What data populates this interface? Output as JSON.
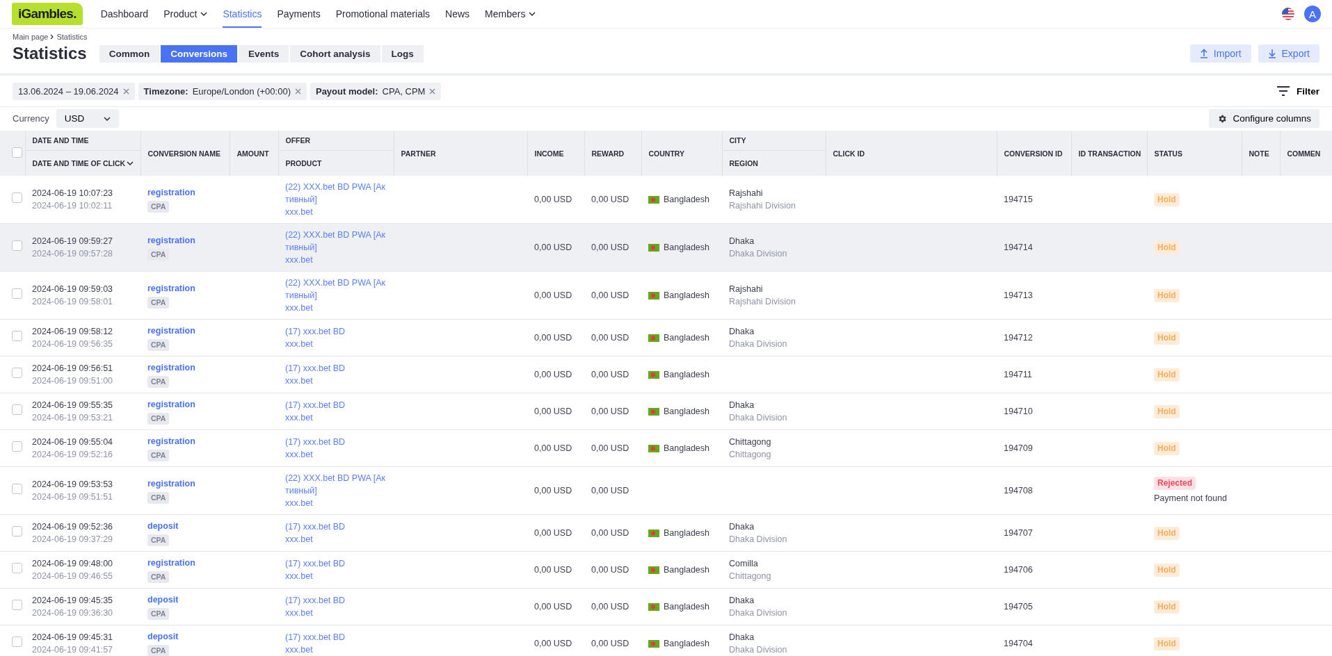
{
  "nav": {
    "logo": "iGambles.",
    "items": [
      {
        "label": "Dashboard",
        "selected": false,
        "dropdown": false
      },
      {
        "label": "Product",
        "selected": false,
        "dropdown": true
      },
      {
        "label": "Statistics",
        "selected": true,
        "dropdown": false
      },
      {
        "label": "Payments",
        "selected": false,
        "dropdown": false
      },
      {
        "label": "Promotional materials",
        "selected": false,
        "dropdown": false
      },
      {
        "label": "News",
        "selected": false,
        "dropdown": false
      },
      {
        "label": "Members",
        "selected": false,
        "dropdown": true
      }
    ],
    "avatar": "A"
  },
  "breadcrumb": [
    "Main page",
    "Statistics"
  ],
  "title": "Statistics",
  "tabs": [
    {
      "label": "Common",
      "selected": false
    },
    {
      "label": "Conversions",
      "selected": true
    },
    {
      "label": "Events",
      "selected": false
    },
    {
      "label": "Cohort analysis",
      "selected": false
    },
    {
      "label": "Logs",
      "selected": false
    }
  ],
  "actions": [
    {
      "label": "Import",
      "kind": "import"
    },
    {
      "label": "Export",
      "kind": "export"
    }
  ],
  "filters": [
    {
      "value": "13.06.2024 – 19.06.2024"
    },
    {
      "label": "Timezone:",
      "value": "Europe/London (+00:00)"
    },
    {
      "label": "Payout model:",
      "value": "CPA, CPM"
    }
  ],
  "filter_button": "Filter",
  "currency": {
    "label": "Currency",
    "value": "USD"
  },
  "configure_button": "Configure columns",
  "table": {
    "select_all_checked": false,
    "columns": [
      {
        "label": "DATE AND TIME",
        "sub": "DATE AND TIME OF CLICK"
      },
      {
        "label": "CONVERSION NAME"
      },
      {
        "label": "AMOUNT"
      },
      {
        "label": "OFFER",
        "sub": "PRODUCT"
      },
      {
        "label": "PARTNER"
      },
      {
        "label": "INCOME"
      },
      {
        "label": "REWARD"
      },
      {
        "label": "COUNTRY"
      },
      {
        "label": "CITY",
        "sub": "REGION"
      },
      {
        "label": "CLICK ID"
      },
      {
        "label": "CONVERSION ID"
      },
      {
        "label": "ID TRANSACTION"
      },
      {
        "label": "STATUS"
      },
      {
        "label": "NOTE"
      },
      {
        "label": "COMMEN"
      }
    ],
    "rows": [
      {
        "checked": false,
        "highlighted": false,
        "date": "2024-06-19 10:07:23",
        "click_date": "2024-06-19 10:02:11",
        "name": "registration",
        "model": "CPA",
        "offer": "(22) XXX.bet BD PWA [Активный]",
        "product": "xxx.bet",
        "income": "0,00 USD",
        "reward": "0,00 USD",
        "country": "Bangladesh",
        "city": "Rajshahi",
        "region": "Rajshahi Division",
        "conversion_id": "194715",
        "status": {
          "kind": "hold",
          "label": "Hold"
        }
      },
      {
        "checked": false,
        "highlighted": true,
        "date": "2024-06-19 09:59:27",
        "click_date": "2024-06-19 09:57:28",
        "name": "registration",
        "model": "CPA",
        "offer": "(22) XXX.bet BD PWA [Активный]",
        "product": "xxx.bet",
        "income": "0,00 USD",
        "reward": "0,00 USD",
        "country": "Bangladesh",
        "city": "Dhaka",
        "region": "Dhaka Division",
        "conversion_id": "194714",
        "status": {
          "kind": "hold",
          "label": "Hold"
        }
      },
      {
        "checked": false,
        "highlighted": false,
        "date": "2024-06-19 09:59:03",
        "click_date": "2024-06-19 09:58:01",
        "name": "registration",
        "model": "CPA",
        "offer": "(22) XXX.bet BD PWA [Активный]",
        "product": "xxx.bet",
        "income": "0,00 USD",
        "reward": "0,00 USD",
        "country": "Bangladesh",
        "city": "Rajshahi",
        "region": "Rajshahi Division",
        "conversion_id": "194713",
        "status": {
          "kind": "hold",
          "label": "Hold"
        }
      },
      {
        "checked": false,
        "highlighted": false,
        "date": "2024-06-19 09:58:12",
        "click_date": "2024-06-19 09:56:35",
        "name": "registration",
        "model": "CPA",
        "offer": "(17) xxx.bet BD",
        "product": "xxx.bet",
        "income": "0,00 USD",
        "reward": "0,00 USD",
        "country": "Bangladesh",
        "city": "Dhaka",
        "region": "Dhaka Division",
        "conversion_id": "194712",
        "status": {
          "kind": "hold",
          "label": "Hold"
        }
      },
      {
        "checked": false,
        "highlighted": false,
        "date": "2024-06-19 09:56:51",
        "click_date": "2024-06-19 09:51:00",
        "name": "registration",
        "model": "CPA",
        "offer": "(17) xxx.bet BD",
        "product": "xxx.bet",
        "income": "0,00 USD",
        "reward": "0,00 USD",
        "country": "Bangladesh",
        "conversion_id": "194711",
        "status": {
          "kind": "hold",
          "label": "Hold"
        }
      },
      {
        "checked": false,
        "highlighted": false,
        "date": "2024-06-19 09:55:35",
        "click_date": "2024-06-19 09:53:21",
        "name": "registration",
        "model": "CPA",
        "offer": "(17) xxx.bet BD",
        "product": "xxx.bet",
        "income": "0,00 USD",
        "reward": "0,00 USD",
        "country": "Bangladesh",
        "city": "Dhaka",
        "region": "Dhaka Division",
        "conversion_id": "194710",
        "status": {
          "kind": "hold",
          "label": "Hold"
        }
      },
      {
        "checked": false,
        "highlighted": false,
        "date": "2024-06-19 09:55:04",
        "click_date": "2024-06-19 09:52:16",
        "name": "registration",
        "model": "CPA",
        "offer": "(17) xxx.bet BD",
        "product": "xxx.bet",
        "income": "0,00 USD",
        "reward": "0,00 USD",
        "country": "Bangladesh",
        "city": "Chittagong",
        "region": "Chittagong",
        "conversion_id": "194709",
        "status": {
          "kind": "hold",
          "label": "Hold"
        }
      },
      {
        "checked": false,
        "highlighted": false,
        "date": "2024-06-19 09:53:53",
        "click_date": "2024-06-19 09:51:51",
        "name": "registration",
        "model": "CPA",
        "offer": "(22) XXX.bet BD PWA [Активный]",
        "product": "xxx.bet",
        "income": "0,00 USD",
        "reward": "0,00 USD",
        "conversion_id": "194708",
        "status": {
          "kind": "rejected",
          "label": "Rejected",
          "note": "Payment not found"
        }
      },
      {
        "checked": false,
        "highlighted": false,
        "date": "2024-06-19 09:52:36",
        "click_date": "2024-06-19 09:37:29",
        "name": "deposit",
        "model": "CPA",
        "offer": "(17) xxx.bet BD",
        "product": "xxx.bet",
        "income": "0,00 USD",
        "reward": "0,00 USD",
        "country": "Bangladesh",
        "city": "Dhaka",
        "region": "Dhaka Division",
        "conversion_id": "194707",
        "status": {
          "kind": "hold",
          "label": "Hold"
        }
      },
      {
        "checked": false,
        "highlighted": false,
        "date": "2024-06-19 09:48:00",
        "click_date": "2024-06-19 09:46:55",
        "name": "registration",
        "model": "CPA",
        "offer": "(17) xxx.bet BD",
        "product": "xxx.bet",
        "income": "0,00 USD",
        "reward": "0,00 USD",
        "country": "Bangladesh",
        "city": "Comilla",
        "region": "Chittagong",
        "conversion_id": "194706",
        "status": {
          "kind": "hold",
          "label": "Hold"
        }
      },
      {
        "checked": false,
        "highlighted": false,
        "date": "2024-06-19 09:45:35",
        "click_date": "2024-06-19 09:36:30",
        "name": "deposit",
        "model": "CPA",
        "offer": "(17) xxx.bet BD",
        "product": "xxx.bet",
        "income": "0,00 USD",
        "reward": "0,00 USD",
        "country": "Bangladesh",
        "city": "Dhaka",
        "region": "Dhaka Division",
        "conversion_id": "194705",
        "status": {
          "kind": "hold",
          "label": "Hold"
        }
      },
      {
        "checked": false,
        "highlighted": false,
        "date": "2024-06-19 09:45:31",
        "click_date": "2024-06-19 09:41:57",
        "name": "deposit",
        "model": "CPA",
        "offer": "(17) xxx.bet BD",
        "product": "xxx.bet",
        "income": "0,00 USD",
        "reward": "0,00 USD",
        "country": "Bangladesh",
        "city": "Dhaka",
        "region": "Dhaka Division",
        "conversion_id": "194704",
        "status": {
          "kind": "hold",
          "label": "Hold"
        }
      }
    ]
  }
}
